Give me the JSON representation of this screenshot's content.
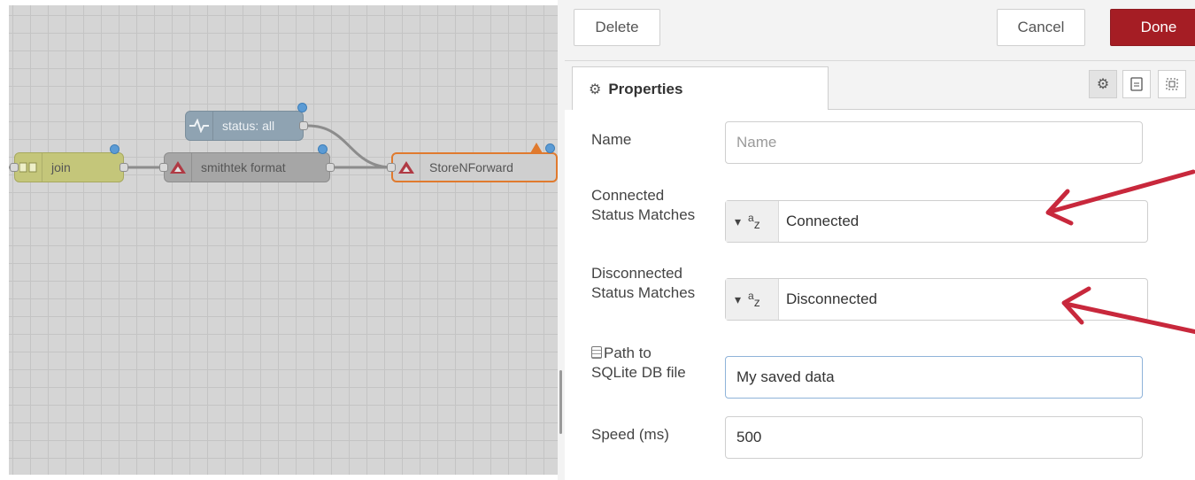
{
  "workspace": {
    "nodes": {
      "join": "join",
      "smithtek": "smithtek format",
      "status": "status: all",
      "store": "StoreNForward"
    }
  },
  "tray": {
    "delete_label": "Delete",
    "cancel_label": "Cancel",
    "done_label": "Done",
    "tab_properties": "Properties"
  },
  "form": {
    "name": {
      "label": "Name",
      "placeholder": "Name",
      "value": ""
    },
    "connected": {
      "label_line1": "Connected",
      "label_line2": "Status Matches",
      "type_icon": "string-type-icon",
      "value": "Connected"
    },
    "disconnected": {
      "label_line1": "Disconnected",
      "label_line2": "Status Matches",
      "type_icon": "string-type-icon",
      "value": "Disconnected"
    },
    "path": {
      "label_line1": "Path to",
      "label_line2": "SQLite DB file",
      "value": "My saved data"
    },
    "speed": {
      "label": "Speed (ms)",
      "value": "500"
    }
  },
  "colors": {
    "done_button": "#a51d24",
    "arrow": "#c8283c",
    "port_dot": "#5b9bd5",
    "join_node": "#c4c67a",
    "smithtek_node": "#a6a6a6",
    "status_node": "#8fa3b2",
    "store_node": "#cfcfcf",
    "warning": "#e07a2e"
  }
}
